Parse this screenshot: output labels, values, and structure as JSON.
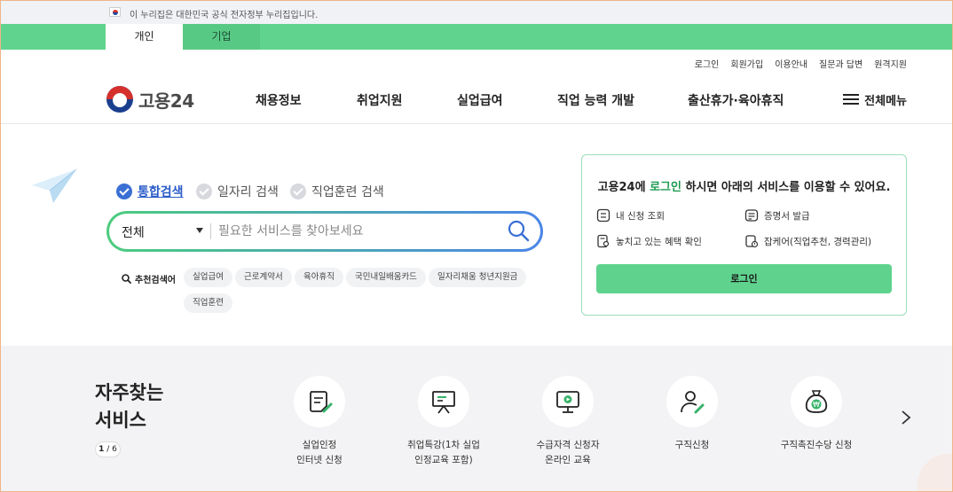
{
  "gov_banner": {
    "text": "이 누리집은 대한민국 공식 전자정부 누리집입니다."
  },
  "user_tabs": [
    {
      "label": "개인",
      "active": true
    },
    {
      "label": "기업",
      "active": false
    }
  ],
  "util_links": [
    "로그인",
    "회원가입",
    "이용안내",
    "질문과 답변",
    "원격지원"
  ],
  "logo": {
    "text": "고용24"
  },
  "gnb": [
    "채용정보",
    "취업지원",
    "실업급여",
    "직업 능력 개발",
    "출산휴가·육아휴직"
  ],
  "all_menu": "전체메뉴",
  "search": {
    "types": [
      {
        "label": "통합검색",
        "selected": true
      },
      {
        "label": "일자리 검색",
        "selected": false
      },
      {
        "label": "직업훈련 검색",
        "selected": false
      }
    ],
    "category": "전체",
    "placeholder": "필요한 서비스를 찾아보세요",
    "value": ""
  },
  "recommended": {
    "label": "추천검색어",
    "keywords": [
      "실업급여",
      "근로계약서",
      "육아휴직",
      "국민내일배움카드",
      "일자리채움 청년지원금",
      "직업훈련"
    ]
  },
  "login_box": {
    "msg_pre": "고용24에 ",
    "msg_highlight": "로그인",
    "msg_post": " 하시면 아래의 서비스를 이용할 수 있어요.",
    "services": [
      "내 신청 조회",
      "증명서 발급",
      "놓치고 있는 혜택 확인",
      "잡케어(직업추천, 경력관리)"
    ],
    "button": "로그인"
  },
  "favorites": {
    "title_line1": "자주찾는",
    "title_line2": "서비스",
    "page_current": "1",
    "page_total": "/ 6",
    "items": [
      {
        "label": "실업인정\n인터넷 신청",
        "icon": "document-pen-icon"
      },
      {
        "label": "취업특강(1차 실업\n인정교육 포함)",
        "icon": "presentation-board-icon"
      },
      {
        "label": "수급자격 신청자\n온라인 교육",
        "icon": "video-monitor-icon"
      },
      {
        "label": "구직신청",
        "icon": "person-pen-icon"
      },
      {
        "label": "구직촉진수당 신청",
        "icon": "money-bag-icon"
      }
    ]
  },
  "colors": {
    "brand_green": "#60d38f",
    "accent_blue": "#3a6fd4",
    "highlight_green": "#1e9a52"
  }
}
